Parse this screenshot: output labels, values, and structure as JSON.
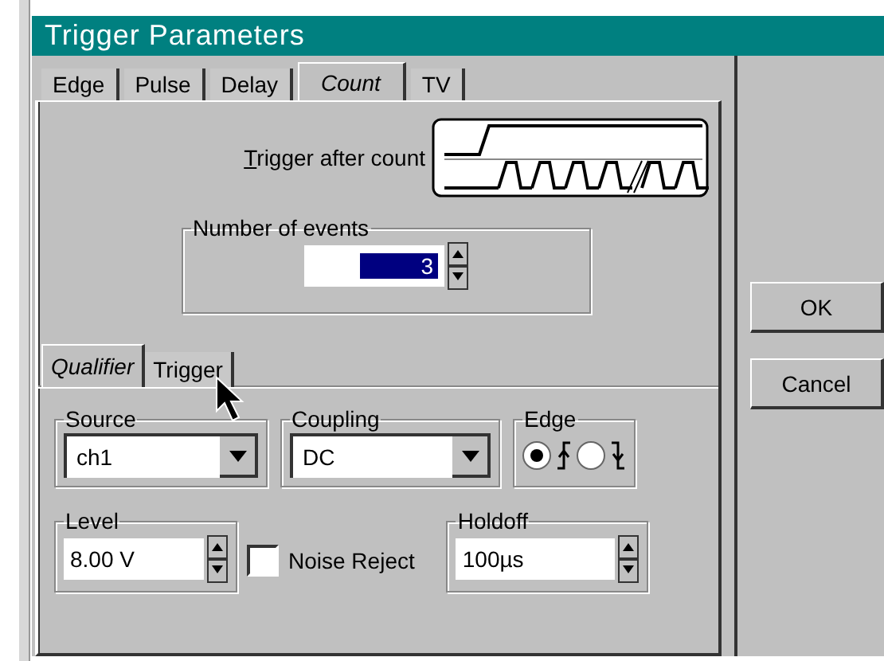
{
  "window": {
    "title": "Trigger Parameters"
  },
  "tabs": [
    {
      "label": "Edge",
      "selected": false
    },
    {
      "label": "Pulse",
      "selected": false
    },
    {
      "label": "Delay",
      "selected": false
    },
    {
      "label": "Count",
      "selected": true
    },
    {
      "label": "TV",
      "selected": false
    }
  ],
  "trigger_after_count": {
    "label": "Trigger after count"
  },
  "number_of_events": {
    "label": "Number of events",
    "value": "3"
  },
  "sub_tabs": [
    {
      "label": "Qualifier",
      "selected": true
    },
    {
      "label": "Trigger",
      "selected": false
    }
  ],
  "source": {
    "label": "Source",
    "value": "ch1"
  },
  "coupling": {
    "label": "Coupling",
    "value": "DC"
  },
  "edge": {
    "label": "Edge",
    "options": [
      {
        "kind": "rising",
        "selected": true
      },
      {
        "kind": "falling",
        "selected": false
      }
    ]
  },
  "level": {
    "label": "Level",
    "value": "8.00 V"
  },
  "noise_reject": {
    "label": "Noise Reject",
    "checked": false
  },
  "holdoff": {
    "label": "Holdoff",
    "value": "100µs"
  },
  "buttons": [
    "OK",
    "Cancel"
  ]
}
